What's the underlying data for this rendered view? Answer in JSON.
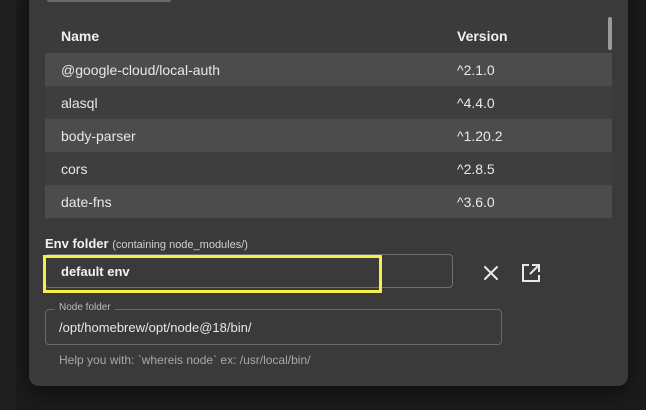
{
  "table": {
    "headers": {
      "name": "Name",
      "version": "Version"
    },
    "rows": [
      {
        "name": "@google-cloud/local-auth",
        "version": "^2.1.0"
      },
      {
        "name": "alasql",
        "version": "^4.4.0"
      },
      {
        "name": "body-parser",
        "version": "^1.20.2"
      },
      {
        "name": "cors",
        "version": "^2.8.5"
      },
      {
        "name": "date-fns",
        "version": "^3.6.0"
      }
    ]
  },
  "env_folder": {
    "label": "Env folder",
    "hint": "(containing node_modules/)",
    "value": "default env",
    "highlight_color": "#f5ef4a"
  },
  "icons": {
    "clear": "close-icon",
    "open": "open-in-new-icon"
  },
  "node_folder": {
    "label": "Node folder",
    "value": "/opt/homebrew/opt/node@18/bin/",
    "helper": "Help you with: `whereis node` ex: /usr/local/bin/"
  }
}
